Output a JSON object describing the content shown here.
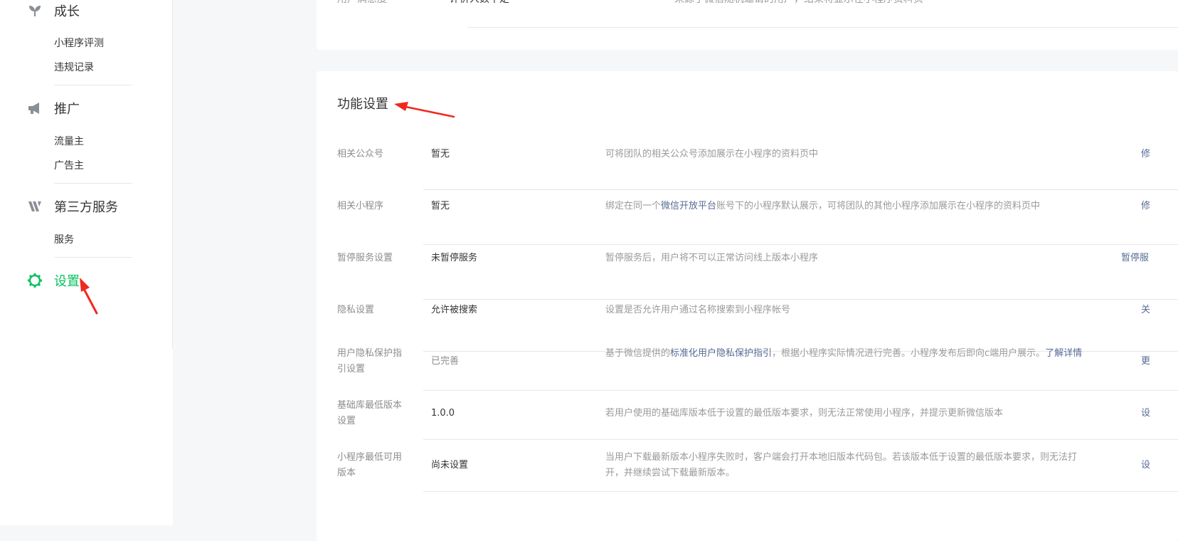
{
  "sidebar": {
    "growth": {
      "label": "成长",
      "items": [
        "小程序评测",
        "违规记录"
      ]
    },
    "promotion": {
      "label": "推广",
      "items": [
        "流量主",
        "广告主"
      ]
    },
    "thirdparty": {
      "label": "第三方服务",
      "items": [
        "服务"
      ]
    },
    "settings": {
      "label": "设置"
    }
  },
  "top_section": {
    "label": "用户满意度",
    "value": "评价人数不足",
    "desc": "来源于微信随机邀请的用户，结果将显示在小程序资料页"
  },
  "feature_settings": {
    "title": "功能设置",
    "rows": [
      {
        "label": "相关公众号",
        "value": "暂无",
        "desc": "可将团队的相关公众号添加展示在小程序的资料页中",
        "action": "修"
      },
      {
        "label": "相关小程序",
        "value": "暂无",
        "desc_pre": "绑定在同一个",
        "desc_link": "微信开放平台",
        "desc_post": "账号下的小程序默认展示，可将团队的其他小程序添加展示在小程序的资料页中",
        "action": "修"
      },
      {
        "label": "暂停服务设置",
        "value": "未暂停服务",
        "desc": "暂停服务后，用户将不可以正常访问线上版本小程序",
        "action": "暂停服"
      },
      {
        "label": "隐私设置",
        "value": "允许被搜索",
        "desc": "设置是否允许用户通过名称搜索到小程序帐号",
        "action": "关"
      },
      {
        "label": "用户隐私保护指引设置",
        "value": "已完善",
        "desc_pre": "基于微信提供的",
        "desc_link": "标准化用户隐私保护指引",
        "desc_post": "，根据小程序实际情况进行完善。小程序发布后即向c端用户展示。",
        "desc_link2": "了解详情",
        "action": "更"
      },
      {
        "label": "基础库最低版本设置",
        "value": "1.0.0",
        "desc": "若用户使用的基础库版本低于设置的最低版本要求，则无法正常使用小程序，并提示更新微信版本",
        "action": "设"
      },
      {
        "label": "小程序最低可用版本",
        "value": "尚未设置",
        "desc": "当用户下载最新版本小程序失败时，客户端会打开本地旧版本代码包。若该版本低于设置的最低版本要求，则无法打开，并继续尝试下载最新版本。",
        "action": "设"
      }
    ]
  },
  "colors": {
    "accent": "#07c160",
    "link": "#576b95",
    "arrow": "#f0291e"
  },
  "icons": [
    "sprout-icon",
    "megaphone-icon",
    "third-party-icon",
    "gear-icon"
  ]
}
